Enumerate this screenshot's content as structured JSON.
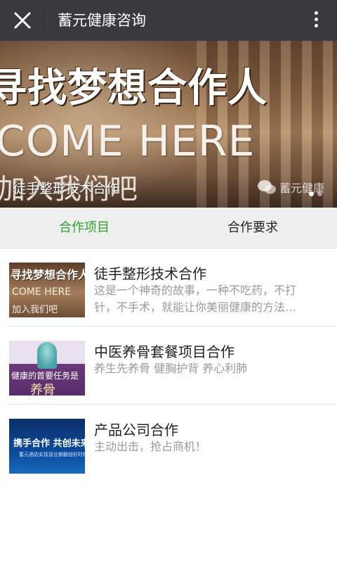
{
  "header": {
    "title": "蓄元健康咨询",
    "close_icon": "close-icon",
    "more_icon": "more-vertical-icon",
    "background": "#393a3f"
  },
  "banner": {
    "headline": "寻找梦想合作人",
    "subline": "COME HERE",
    "join_text": "加入我们吧",
    "caption": "徒手整形技术合作",
    "watermark": "蓄元健康",
    "slide_count": 2,
    "active_slide": 1
  },
  "tabs": {
    "items": [
      {
        "label": "合作项目",
        "active": true
      },
      {
        "label": "合作要求",
        "active": false
      }
    ],
    "active_color": "#2aa52a"
  },
  "list": [
    {
      "title": "徒手整形技术合作",
      "desc": "这是一个神奇的故事，一种不吃药，不打针，不手术，就能让你美丽健康的方法…",
      "thumb": {
        "line1": "寻找梦想合作人",
        "line2": "COME HERE",
        "line3": "加入我们吧"
      }
    },
    {
      "title": "中医养骨套餐项目合作",
      "desc": "养生先养骨 健胸护背 养心利肺",
      "thumb": {
        "line1": "健康的首要任务是",
        "line2": "养骨"
      }
    },
    {
      "title": "产品公司合作",
      "desc": "主动出击，抢占商机！",
      "thumb": {
        "line1": "携手合作 共创未来",
        "line2": "蓄元酒店实现营业额翻倍好时机"
      }
    }
  ]
}
